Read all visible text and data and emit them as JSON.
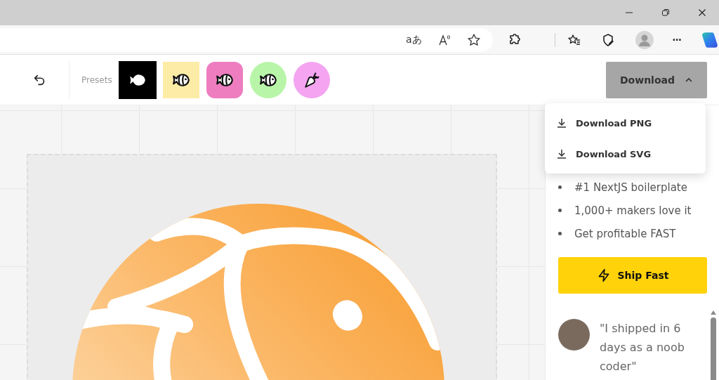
{
  "browser": {
    "translate_glyph": "aあ",
    "more_glyph": "···"
  },
  "toolbar": {
    "presets_label": "Presets",
    "presets": [
      {
        "kind": "solid",
        "color": "#000000",
        "selected": true
      },
      {
        "kind": "square",
        "color": "#fdeca6",
        "selected": false
      },
      {
        "kind": "rounded",
        "color": "#ee7dc0",
        "selected": false
      },
      {
        "kind": "circle",
        "color": "#b8f5a8",
        "selected": false
      },
      {
        "kind": "carrot",
        "color": "#f4a4f0",
        "selected": false
      }
    ],
    "download": {
      "label": "Download",
      "expanded": true,
      "options": [
        "Download PNG",
        "Download SVG"
      ]
    }
  },
  "sidebar": {
    "bullets": [
      "#1 NextJS boilerplate",
      "1,000+ makers love it",
      "Get profitable FAST"
    ],
    "cta": "Ship Fast",
    "testimonial": "\"I shipped in 6 days as a noob coder\""
  }
}
